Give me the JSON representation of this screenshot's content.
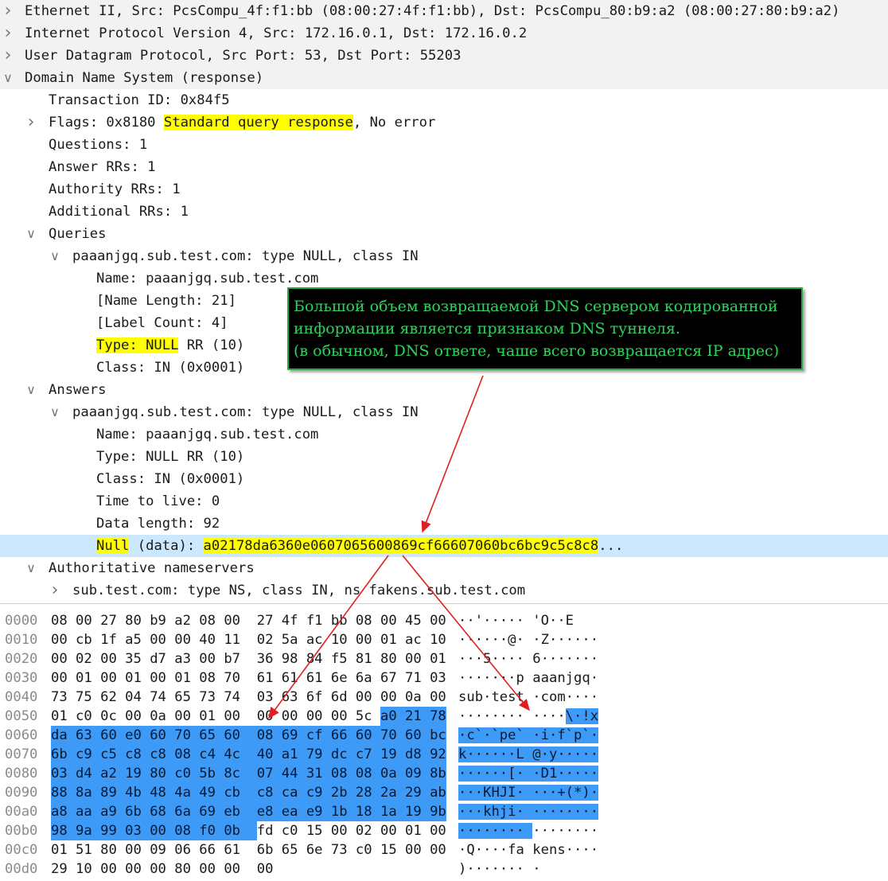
{
  "tree": [
    {
      "indent": 0,
      "arrow": "collapsed",
      "text": "Ethernet II, Src: PcsCompu_4f:f1:bb (08:00:27:4f:f1:bb), Dst: PcsCompu_80:b9:a2 (08:00:27:80:b9:a2)",
      "shade": true
    },
    {
      "indent": 0,
      "arrow": "collapsed",
      "text": "Internet Protocol Version 4, Src: 172.16.0.1, Dst: 172.16.0.2",
      "shade": true
    },
    {
      "indent": 0,
      "arrow": "collapsed",
      "text": "User Datagram Protocol, Src Port: 53, Dst Port: 55203",
      "shade": true
    },
    {
      "indent": 0,
      "arrow": "expanded",
      "text": "Domain Name System (response)",
      "shade": true
    },
    {
      "indent": 1,
      "arrow": "none",
      "text": "Transaction ID: 0x84f5"
    },
    {
      "indent": 1,
      "arrow": "collapsed",
      "pre": "Flags: 0x8180 ",
      "hl": "Standard query response",
      "post": ", No error"
    },
    {
      "indent": 1,
      "arrow": "none",
      "text": "Questions: 1"
    },
    {
      "indent": 1,
      "arrow": "none",
      "text": "Answer RRs: 1"
    },
    {
      "indent": 1,
      "arrow": "none",
      "text": "Authority RRs: 1"
    },
    {
      "indent": 1,
      "arrow": "none",
      "text": "Additional RRs: 1"
    },
    {
      "indent": 1,
      "arrow": "expanded",
      "text": "Queries"
    },
    {
      "indent": 2,
      "arrow": "expanded",
      "text": "paaanjgq.sub.test.com: type NULL, class IN"
    },
    {
      "indent": 3,
      "arrow": "none",
      "text": "Name: paaanjgq.sub.test.com"
    },
    {
      "indent": 3,
      "arrow": "none",
      "text": "[Name Length: 21]"
    },
    {
      "indent": 3,
      "arrow": "none",
      "text": "[Label Count: 4]"
    },
    {
      "indent": 3,
      "arrow": "none",
      "hl": "Type: NULL",
      "post": " RR (10)"
    },
    {
      "indent": 3,
      "arrow": "none",
      "text": "Class: IN (0x0001)"
    },
    {
      "indent": 1,
      "arrow": "expanded",
      "text": "Answers"
    },
    {
      "indent": 2,
      "arrow": "expanded",
      "text": "paaanjgq.sub.test.com: type NULL, class IN"
    },
    {
      "indent": 3,
      "arrow": "none",
      "text": "Name: paaanjgq.sub.test.com"
    },
    {
      "indent": 3,
      "arrow": "none",
      "text": "Type: NULL RR (10)"
    },
    {
      "indent": 3,
      "arrow": "none",
      "text": "Class: IN (0x0001)"
    },
    {
      "indent": 3,
      "arrow": "none",
      "text": "Time to live: 0"
    },
    {
      "indent": 3,
      "arrow": "none",
      "text": "Data length: 92"
    },
    {
      "indent": 3,
      "arrow": "none",
      "hl": "Null",
      "mid": " (data): ",
      "hl2": "a02178da6360e0607065600869cf66607060bc6bc9c5c8c8",
      "post": "...",
      "selected": true
    },
    {
      "indent": 1,
      "arrow": "expanded",
      "text": "Authoritative nameservers"
    },
    {
      "indent": 2,
      "arrow": "collapsed",
      "text": "sub.test.com: type NS, class IN, ns fakens.sub.test.com"
    }
  ],
  "hex": [
    {
      "off": "0000",
      "bytes": [
        "08",
        "00",
        "27",
        "80",
        "b9",
        "a2",
        "08",
        "00",
        "27",
        "4f",
        "f1",
        "bb",
        "08",
        "00",
        "45",
        "00"
      ],
      "ascii": "··'····· 'O··E"
    },
    {
      "off": "0010",
      "bytes": [
        "00",
        "cb",
        "1f",
        "a5",
        "00",
        "00",
        "40",
        "11",
        "02",
        "5a",
        "ac",
        "10",
        "00",
        "01",
        "ac",
        "10"
      ],
      "ascii": "······@· ·Z······"
    },
    {
      "off": "0020",
      "bytes": [
        "00",
        "02",
        "00",
        "35",
        "d7",
        "a3",
        "00",
        "b7",
        "36",
        "98",
        "84",
        "f5",
        "81",
        "80",
        "00",
        "01"
      ],
      "ascii": "···5···· 6·······"
    },
    {
      "off": "0030",
      "bytes": [
        "00",
        "01",
        "00",
        "01",
        "00",
        "01",
        "08",
        "70",
        "61",
        "61",
        "61",
        "6e",
        "6a",
        "67",
        "71",
        "03"
      ],
      "ascii": "·······p aaanjgq·"
    },
    {
      "off": "0040",
      "bytes": [
        "73",
        "75",
        "62",
        "04",
        "74",
        "65",
        "73",
        "74",
        "03",
        "63",
        "6f",
        "6d",
        "00",
        "00",
        "0a",
        "00"
      ],
      "ascii": "sub·test ·com····"
    },
    {
      "off": "0050",
      "bytes": [
        "01",
        "c0",
        "0c",
        "00",
        "0a",
        "00",
        "01",
        "00",
        "00",
        "00",
        "00",
        "00",
        "5c",
        "a0",
        "21",
        "78"
      ],
      "ascii": "········ ····\\·!x"
    },
    {
      "off": "0060",
      "bytes": [
        "da",
        "63",
        "60",
        "e0",
        "60",
        "70",
        "65",
        "60",
        "08",
        "69",
        "cf",
        "66",
        "60",
        "70",
        "60",
        "bc"
      ],
      "ascii": "·c`·`pe` ·i·f`p`·"
    },
    {
      "off": "0070",
      "bytes": [
        "6b",
        "c9",
        "c5",
        "c8",
        "c8",
        "08",
        "c4",
        "4c",
        "40",
        "a1",
        "79",
        "dc",
        "c7",
        "19",
        "d8",
        "92"
      ],
      "ascii": "k······L @·y·····"
    },
    {
      "off": "0080",
      "bytes": [
        "03",
        "d4",
        "a2",
        "19",
        "80",
        "c0",
        "5b",
        "8c",
        "07",
        "44",
        "31",
        "08",
        "08",
        "0a",
        "09",
        "8b"
      ],
      "ascii": "······[· ·D1·····"
    },
    {
      "off": "0090",
      "bytes": [
        "88",
        "8a",
        "89",
        "4b",
        "48",
        "4a",
        "49",
        "cb",
        "c8",
        "ca",
        "c9",
        "2b",
        "28",
        "2a",
        "29",
        "ab"
      ],
      "ascii": "···KHJI· ···+(*)·"
    },
    {
      "off": "00a0",
      "bytes": [
        "a8",
        "aa",
        "a9",
        "6b",
        "68",
        "6a",
        "69",
        "eb",
        "e8",
        "ea",
        "e9",
        "1b",
        "18",
        "1a",
        "19",
        "9b"
      ],
      "ascii": "···khji· ········"
    },
    {
      "off": "00b0",
      "bytes": [
        "98",
        "9a",
        "99",
        "03",
        "00",
        "08",
        "f0",
        "0b",
        "fd",
        "c0",
        "15",
        "00",
        "02",
        "00",
        "01",
        "00"
      ],
      "ascii": "········ ········"
    },
    {
      "off": "00c0",
      "bytes": [
        "01",
        "51",
        "80",
        "00",
        "09",
        "06",
        "66",
        "61",
        "6b",
        "65",
        "6e",
        "73",
        "c0",
        "15",
        "00",
        "00"
      ],
      "ascii": "·Q····fa kens····"
    },
    {
      "off": "00d0",
      "bytes": [
        "29",
        "10",
        "00",
        "00",
        "00",
        "80",
        "00",
        "00",
        "00"
      ],
      "ascii": ")······· ·"
    }
  ],
  "callout": {
    "lines": [
      "Большой объем возвращаемой DNS сервером кодированной",
      "информации является признаком DNS туннеля.",
      "(в обычном, DNS ответе, чаше всего  возвращается IP адрес)"
    ]
  },
  "colors": {
    "highlight": "#ffff00",
    "selection": "#3d9af7",
    "selected_row": "#cce8ff",
    "callout_text": "#2fd35c",
    "arrow": "#e02020"
  }
}
